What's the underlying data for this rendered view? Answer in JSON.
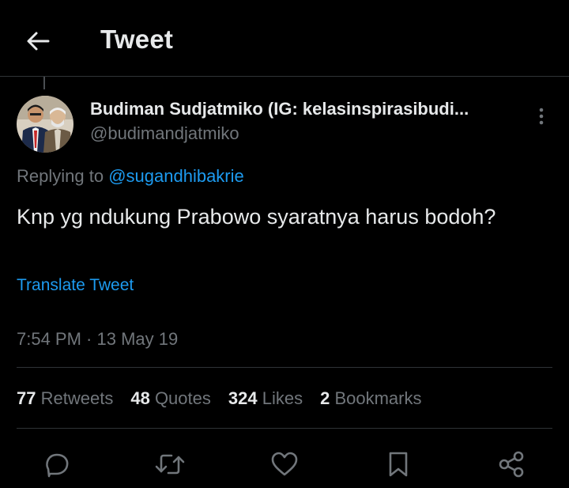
{
  "header": {
    "title": "Tweet"
  },
  "author": {
    "display_name": "Budiman Sudjatmiko (IG: kelasinspirasibudi...",
    "handle": "@budimandjatmiko"
  },
  "reply": {
    "prefix": "Replying to",
    "mention": "@sugandhibakrie"
  },
  "tweet": {
    "text": "Knp yg ndukung Prabowo syaratnya harus bodoh?",
    "translate_label": "Translate Tweet",
    "timestamp": "7:54 PM · 13 May 19"
  },
  "stats": {
    "retweets_count": "77",
    "retweets_label": "Retweets",
    "quotes_count": "48",
    "quotes_label": "Quotes",
    "likes_count": "324",
    "likes_label": "Likes",
    "bookmarks_count": "2",
    "bookmarks_label": "Bookmarks"
  },
  "colors": {
    "background": "#000000",
    "text_primary": "#e7e9ea",
    "text_secondary": "#71767b",
    "accent": "#1d9bf0",
    "divider": "#2f3336"
  },
  "icons": {
    "back": "arrow-left-icon",
    "more": "more-vertical-icon",
    "reply": "reply-icon",
    "retweet": "retweet-icon",
    "like": "heart-icon",
    "bookmark": "bookmark-icon",
    "share": "share-icon"
  }
}
